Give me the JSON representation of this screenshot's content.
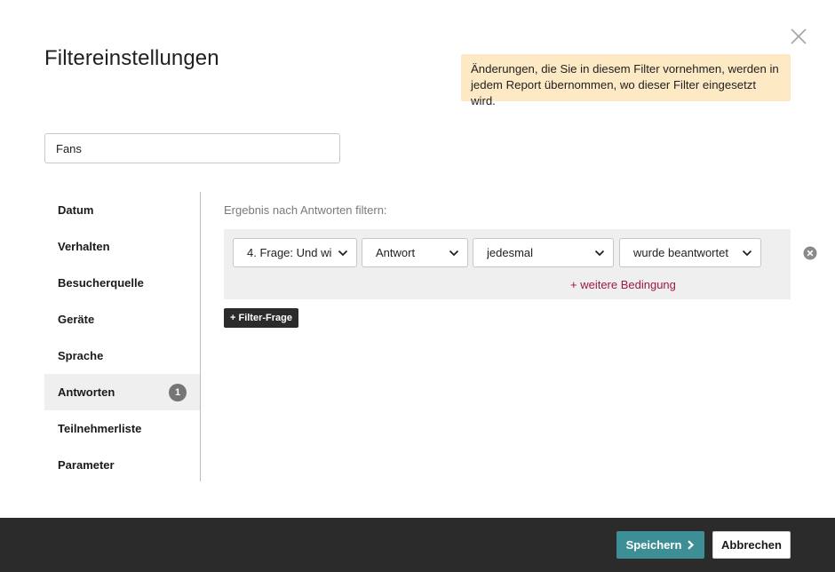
{
  "dialog": {
    "title": "Filtereinstellungen",
    "notice": "Änderungen, die Sie in diesem Filter vornehmen, werden in jedem Report übernommen, wo dieser Filter eingesetzt wird."
  },
  "filter_name": {
    "value": "Fans"
  },
  "sidebar": {
    "items": [
      {
        "label": "Datum"
      },
      {
        "label": "Verhalten"
      },
      {
        "label": "Besucherquelle"
      },
      {
        "label": "Geräte"
      },
      {
        "label": "Sprache"
      },
      {
        "label": "Antworten",
        "badge": "1",
        "active": true
      },
      {
        "label": "Teilnehmerliste"
      },
      {
        "label": "Parameter"
      }
    ]
  },
  "main": {
    "section_label": "Ergebnis nach Antworten filtern:",
    "condition": {
      "question": "4. Frage: Und wi",
      "field": "Antwort",
      "value": "jedesmal",
      "operator": "wurde beantwortet"
    },
    "add_condition_label": "+ weitere Bedingung",
    "add_filter_question_label": "+ Filter-Frage"
  },
  "footer": {
    "save_label": "Speichern",
    "cancel_label": "Abbrechen"
  },
  "colors": {
    "notice_bg": "#fde9c4",
    "save_bg": "#3e8e95",
    "footer_bg": "#2b2b2b",
    "link": "#9b1b3f"
  },
  "icons": {
    "close": "close-icon",
    "remove": "remove-circle-icon",
    "chevron": "chevron-down-icon",
    "save_arrow": "chevron-right-icon"
  }
}
